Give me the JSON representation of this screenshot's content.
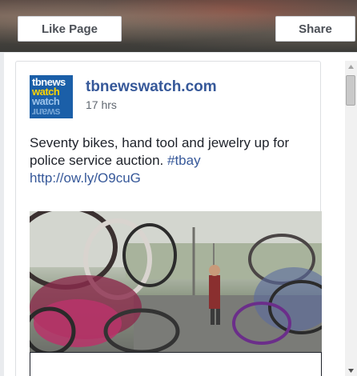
{
  "cover": {
    "like_label": "Like Page",
    "share_label": "Share"
  },
  "post": {
    "avatar_lines": [
      "tbnews",
      "watch",
      "watch",
      "ɹuɐʍs"
    ],
    "page_name": "tbnewswatch.com",
    "timestamp": "17 hrs",
    "text": "Seventy bikes, hand tool and jewelry up for police service auction. ",
    "hashtag": "#tbay",
    "link": "http://ow.ly/O9cuG"
  },
  "colors": {
    "link": "#365899",
    "avatar_bg": "#1b5fa8"
  },
  "icons": {
    "scroll_up": "triangle-up-icon",
    "scroll_down": "triangle-down-icon"
  }
}
